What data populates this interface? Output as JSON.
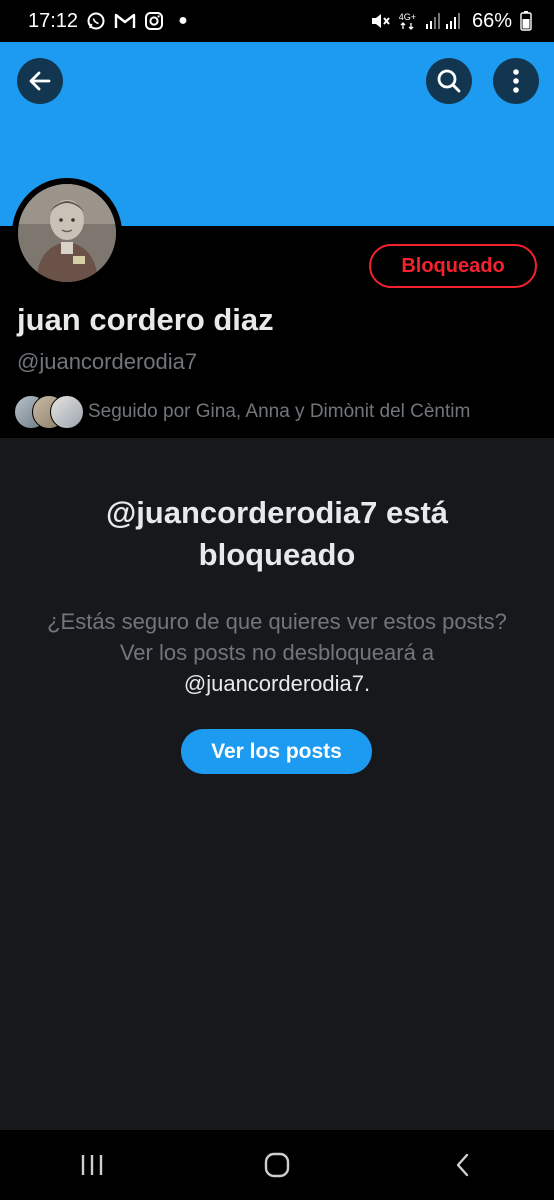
{
  "status_bar": {
    "time": "17:12",
    "network": "4G+",
    "battery": "66%",
    "icons": [
      "whatsapp-icon",
      "gmail-icon",
      "instagram-icon",
      "dot-icon",
      "mute-icon",
      "signal-icon",
      "battery-icon"
    ]
  },
  "header": {
    "back_icon": "arrow-left-icon",
    "search_icon": "search-icon",
    "more_icon": "more-vertical-icon",
    "banner_color": "#1d9bf0"
  },
  "profile": {
    "display_name": "juan cordero diaz",
    "handle": "@juancorderodia7",
    "blocked_label": "Bloqueado",
    "followed_by": "Seguido por Gina, Anna y Dimònit del Cèntim"
  },
  "blocked_notice": {
    "title": "@juancorderodia7 está bloqueado",
    "description_text": "¿Estás seguro de que quieres ver estos posts? Ver los posts no desbloqueará a",
    "description_handle": "@juancorderodia7.",
    "button_label": "Ver los posts"
  },
  "nav_bar": {
    "icons": [
      "recent-apps-icon",
      "home-icon",
      "back-icon"
    ]
  },
  "colors": {
    "accent": "#1d9bf0",
    "danger": "#f4212e",
    "background": "#16181c",
    "muted_text": "#71767b"
  }
}
